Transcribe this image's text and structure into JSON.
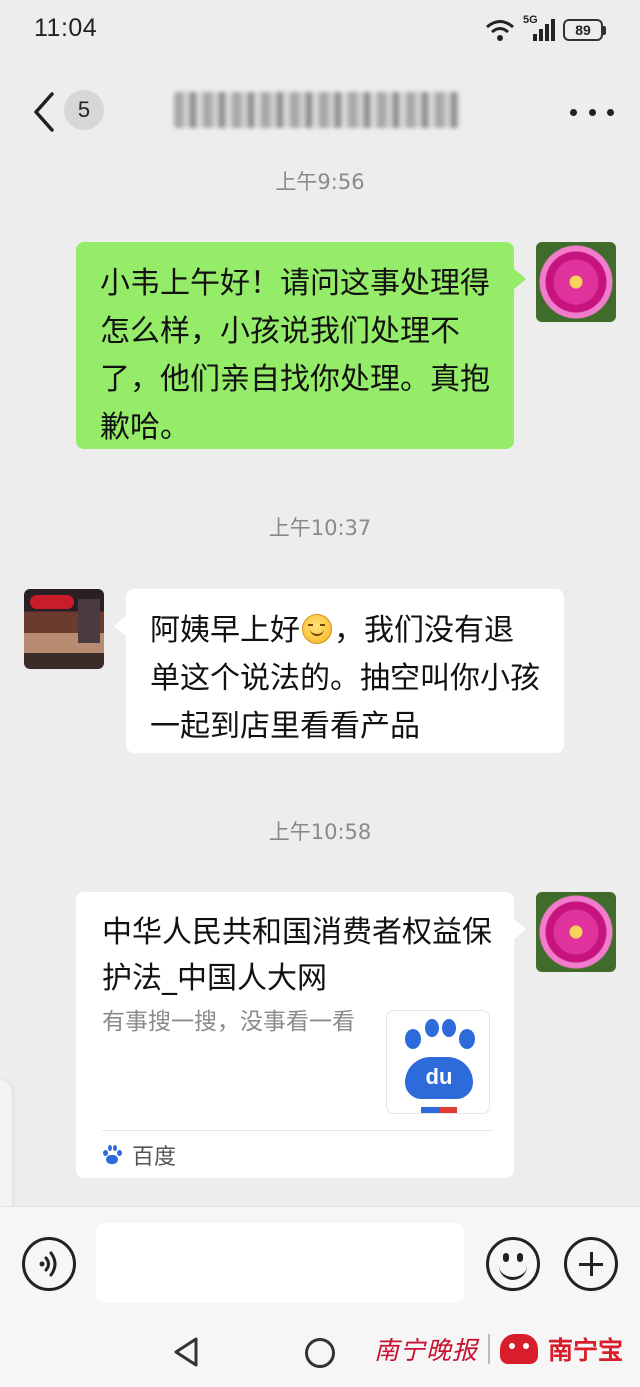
{
  "status_bar": {
    "time": "11:04",
    "network": "5G",
    "battery": "89"
  },
  "header": {
    "unread_count": "5"
  },
  "messages": [
    {
      "timestamp": "上午9:56",
      "sender": "self",
      "text": "小韦上午好！请问这事处理得怎么样，小孩说我们处理不了，他们亲自找你处理。真抱歉哈。"
    },
    {
      "timestamp": "上午10:37",
      "sender": "other",
      "text_before_emoji": "阿姨早上好",
      "emoji": "smile-emoji",
      "text_after_emoji": "，我们没有退单这个说法的。抽空叫你小孩一起到店里看看产品"
    },
    {
      "timestamp": "上午10:58",
      "sender": "self",
      "type": "link_card",
      "card": {
        "title": "中华人民共和国消费者权益保护法_中国人大网",
        "description": "有事搜一搜，没事看一看",
        "thumb_text": "du",
        "source": "百度"
      }
    }
  ],
  "input_bar": {
    "placeholder": ""
  },
  "watermark": {
    "newspaper": "南宁晚报",
    "app": "南宁宝"
  },
  "colors": {
    "self_bubble": "#95ec69",
    "other_bubble": "#ffffff",
    "background": "#ededed"
  }
}
